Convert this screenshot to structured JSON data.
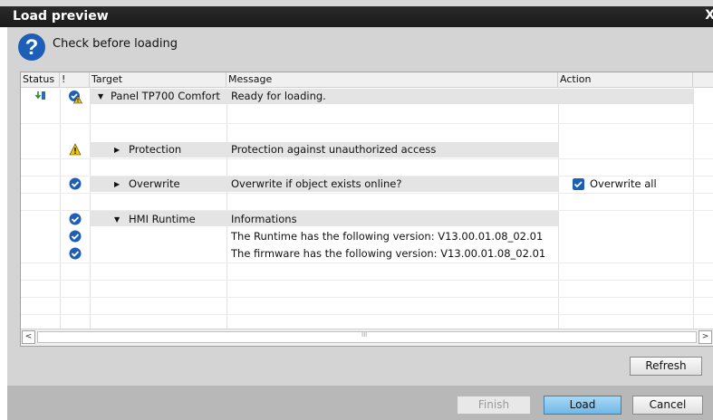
{
  "dialog": {
    "title": "Load preview",
    "close_glyph": "X",
    "subtitle": "Check before loading",
    "help_icon": "question-circle-icon"
  },
  "table": {
    "headers": {
      "status": "Status",
      "bang": "!",
      "target": "Target",
      "message": "Message",
      "action": "Action"
    },
    "rows": [
      {
        "status_icon": "download-arrow-icon",
        "check_icon": "check-warning-icon",
        "expander": "▼",
        "target": "Panel TP700 Comfort",
        "message": "Ready for loading.",
        "action": ""
      },
      {
        "check_icon": "",
        "target": "",
        "message": "",
        "action": ""
      },
      {
        "check_icon": "warning-icon",
        "expander": "▶",
        "target": "Protection",
        "message": "Protection against unauthorized access",
        "action": ""
      },
      {
        "check_icon": "",
        "target": "",
        "message": "",
        "action": ""
      },
      {
        "check_icon": "check-icon",
        "expander": "▶",
        "target": "Overwrite",
        "message": "Overwrite if object exists online?",
        "action": "Overwrite all",
        "action_checked": true
      },
      {
        "check_icon": "",
        "target": "",
        "message": "",
        "action": ""
      },
      {
        "check_icon": "check-icon",
        "expander": "▼",
        "target": "HMI Runtime",
        "message": "Informations",
        "action": ""
      },
      {
        "check_icon": "check-icon",
        "target": "",
        "message": "The Runtime has the following version: V13.00.01.08_02.01",
        "action": ""
      },
      {
        "check_icon": "check-icon",
        "target": "",
        "message": "The firmware has the following version: V13.00.01.08_02.01",
        "action": ""
      }
    ],
    "scroll_left": "<",
    "scroll_right": ">",
    "scroll_grip": "III"
  },
  "buttons": {
    "refresh": "Refresh",
    "finish": "Finish",
    "load": "Load",
    "cancel": "Cancel"
  },
  "colors": {
    "accent_blue": "#1d5fb6",
    "warning_yellow": "#f4c400",
    "load_button": "#7cc0ea"
  }
}
